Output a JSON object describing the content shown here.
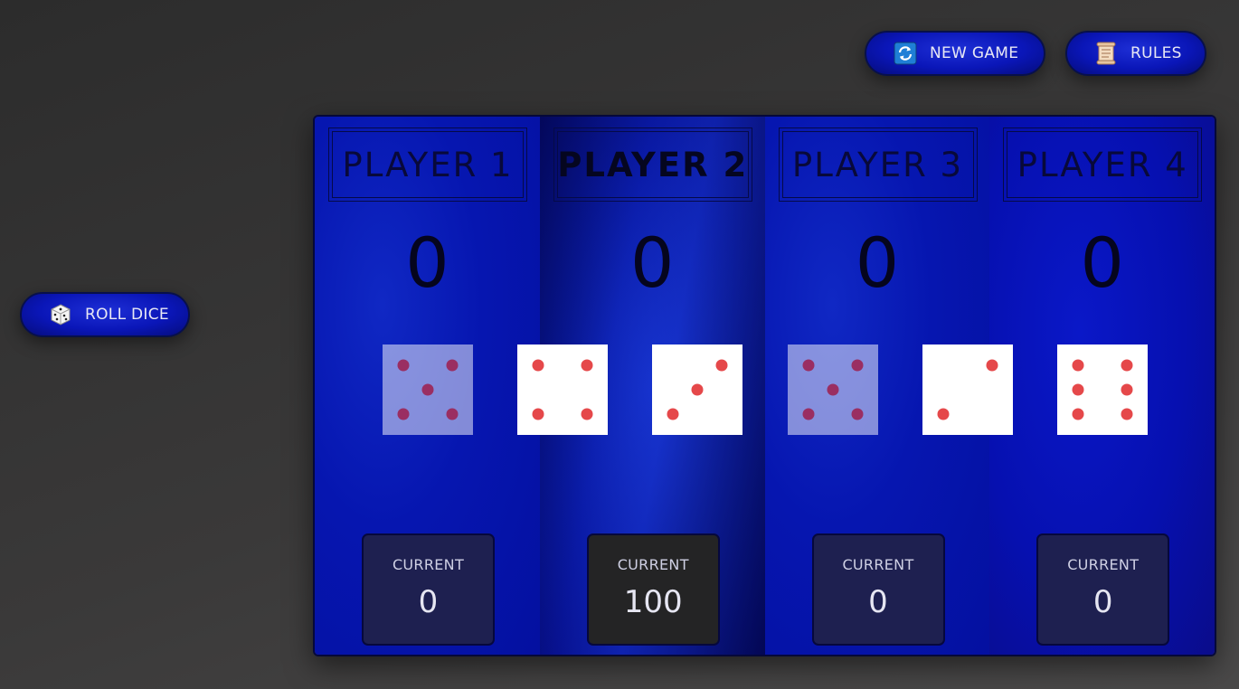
{
  "buttons": {
    "new_game": {
      "label": "NEW GAME",
      "icon": "refresh-icon"
    },
    "rules": {
      "label": "RULES",
      "icon": "scroll-icon"
    },
    "roll_dice": {
      "label": "ROLL DICE",
      "icon": "dice-icon"
    }
  },
  "active_player": 2,
  "players": [
    {
      "name": "PLAYER 1",
      "score": "0",
      "current_label": "CURRENT",
      "current": "0"
    },
    {
      "name": "PLAYER 2",
      "score": "0",
      "current_label": "CURRENT",
      "current": "100"
    },
    {
      "name": "PLAYER 3",
      "score": "0",
      "current_label": "CURRENT",
      "current": "0"
    },
    {
      "name": "PLAYER 4",
      "score": "0",
      "current_label": "CURRENT",
      "current": "0"
    }
  ],
  "dice": [
    {
      "value": 5,
      "faded": true
    },
    {
      "value": 4,
      "faded": false
    },
    {
      "value": 3,
      "faded": false
    },
    {
      "value": 5,
      "faded": true
    },
    {
      "value": 2,
      "faded": false
    },
    {
      "value": 6,
      "faded": false
    }
  ],
  "colors": {
    "pip": "#e5484a",
    "pip_faded": "#9a2e62",
    "button_bg": "#0a16b8",
    "board_bg": "#0616b0",
    "current_bg": "#1e2050",
    "current_active_bg": "#242425"
  }
}
